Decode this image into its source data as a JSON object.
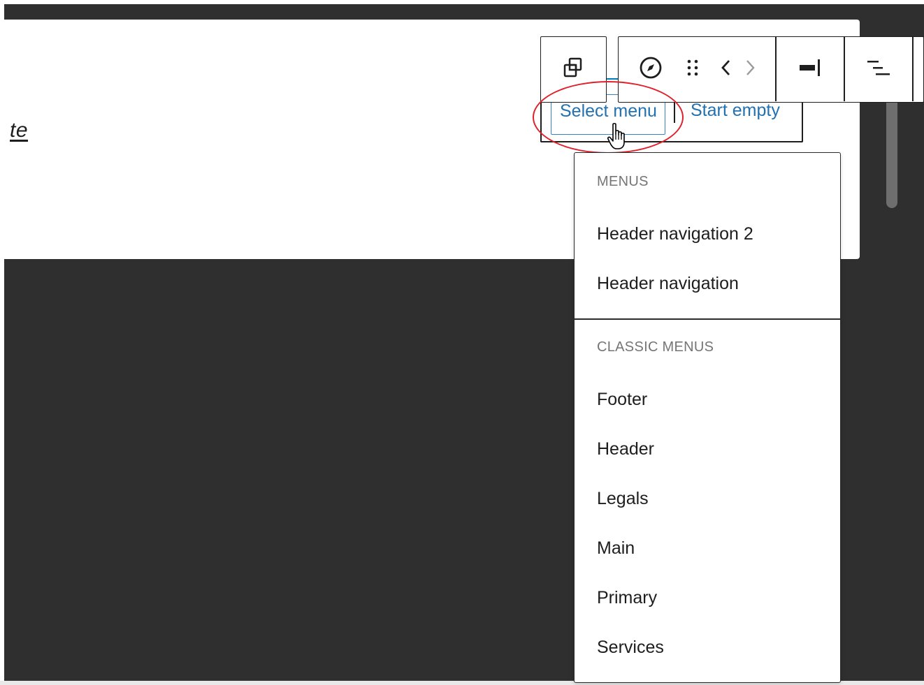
{
  "canvas": {
    "partial_link_text": "te"
  },
  "placeholder": {
    "select_menu_label": "Select menu",
    "start_empty_label": "Start empty"
  },
  "toolbar": {
    "icons": [
      "duplicate-icon",
      "compass-icon",
      "drag-handle-icon",
      "chevron-left-icon",
      "chevron-right-icon",
      "justify-right-icon",
      "align-text-icon"
    ]
  },
  "dropdown": {
    "groups": [
      {
        "title": "MENUS",
        "items": [
          "Header navigation 2",
          "Header navigation"
        ]
      },
      {
        "title": "CLASSIC MENUS",
        "items": [
          "Footer",
          "Header",
          "Legals",
          "Main",
          "Primary",
          "Services"
        ]
      }
    ]
  },
  "colors": {
    "accent": "#2271b1",
    "annotation": "#e0202a",
    "backdrop": "#2f2f2f"
  }
}
